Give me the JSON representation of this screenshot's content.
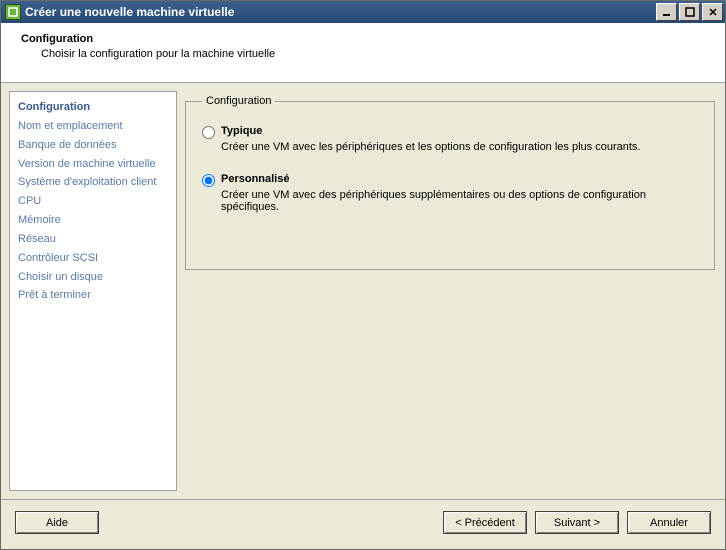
{
  "titlebar": {
    "title": "Créer une nouvelle machine virtuelle"
  },
  "header": {
    "title": "Configuration",
    "subtitle": "Choisir la configuration pour la machine virtuelle"
  },
  "sidebar": {
    "items": [
      {
        "label": "Configuration",
        "active": true
      },
      {
        "label": "Nom et emplacement"
      },
      {
        "label": "Banque de données"
      },
      {
        "label": "Version de machine virtuelle"
      },
      {
        "label": "Système d'exploitation client"
      },
      {
        "label": "CPU"
      },
      {
        "label": "Mémoire"
      },
      {
        "label": "Réseau"
      },
      {
        "label": "Contrôleur SCSI"
      },
      {
        "label": "Choisir un disque"
      },
      {
        "label": "Prêt à terminer"
      }
    ]
  },
  "group": {
    "legend": "Configuration",
    "options": [
      {
        "title": "Typique",
        "desc": "Créer une VM avec les périphériques et les options de configuration les plus courants.",
        "selected": false
      },
      {
        "title": "Personnalisé",
        "desc": "Créer une VM avec des périphériques supplémentaires ou des options de configuration spécifiques.",
        "selected": true
      }
    ]
  },
  "footer": {
    "help": "Aide",
    "back": "< Précédent",
    "next": "Suivant >",
    "cancel": "Annuler"
  }
}
